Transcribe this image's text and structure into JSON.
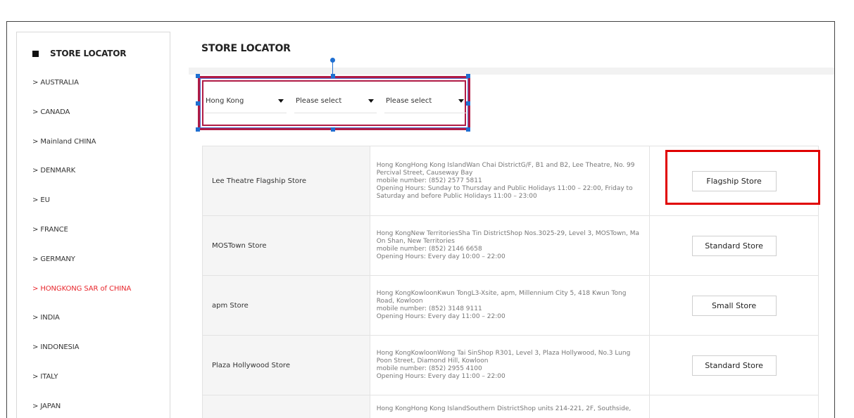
{
  "sidebar": {
    "title": "STORE LOCATOR",
    "items": [
      {
        "label": "> AUSTRALIA",
        "active": false
      },
      {
        "label": "> CANADA",
        "active": false
      },
      {
        "label": "> Mainland CHINA",
        "active": false
      },
      {
        "label": "> DENMARK",
        "active": false
      },
      {
        "label": "> EU",
        "active": false
      },
      {
        "label": "> FRANCE",
        "active": false
      },
      {
        "label": "> GERMANY",
        "active": false
      },
      {
        "label": "> HONGKONG SAR of CHINA",
        "active": true
      },
      {
        "label": "> INDIA",
        "active": false
      },
      {
        "label": "> INDONESIA",
        "active": false
      },
      {
        "label": "> ITALY",
        "active": false
      },
      {
        "label": "> JAPAN",
        "active": false
      }
    ]
  },
  "main": {
    "title": "STORE LOCATOR",
    "filters": {
      "region": "Hong Kong",
      "district": "Please select",
      "area": "Please select"
    },
    "stores": [
      {
        "name": "Lee Theatre Flagship Store",
        "address": "Hong KongHong Kong IslandWan Chai DistrictG/F, B1 and B2, Lee Theatre, No. 99 Percival Street, Causeway Bay",
        "phone": "mobile number: (852) 2577 5811",
        "hours": "Opening Hours: Sunday to Thursday and Public Holidays 11:00 – 22:00, Friday to Saturday and before Public Holidays 11:00 – 23:00",
        "type": "Flagship Store"
      },
      {
        "name": "MOSTown Store",
        "address": "Hong KongNew TerritoriesSha Tin DistrictShop Nos.3025-29, Level 3, MOSTown, Ma On Shan, New Territories",
        "phone": "mobile number: (852) 2146 6658",
        "hours": "Opening Hours: Every day 10:00 – 22:00",
        "type": "Standard Store"
      },
      {
        "name": "apm Store",
        "address": "Hong KongKowloonKwun TongL3-Xsite, apm, Millennium City 5, 418 Kwun Tong Road, Kowloon",
        "phone": "mobile number: (852) 3148 9111",
        "hours": "Opening Hours: Every day 11:00 – 22:00",
        "type": "Small Store"
      },
      {
        "name": "Plaza Hollywood Store",
        "address": "Hong KongKowloonWong Tai SinShop R301, Level 3, Plaza Hollywood, No.3 Lung Poon Street, Diamond Hill, Kowloon",
        "phone": "mobile number: (852) 2955 4100",
        "hours": "Opening Hours: Every day 11:00 – 22:00",
        "type": "Standard Store"
      },
      {
        "name": "",
        "address": "Hong KongHong Kong IslandSouthern DistrictShop units 214-221, 2F, Southside,",
        "phone": "",
        "hours": "",
        "type": ""
      }
    ]
  },
  "colors": {
    "active_link": "#e8272d",
    "highlight_box": "#e00000",
    "selection_border": "#b11b45",
    "selection_handle": "#1f6fd1"
  }
}
